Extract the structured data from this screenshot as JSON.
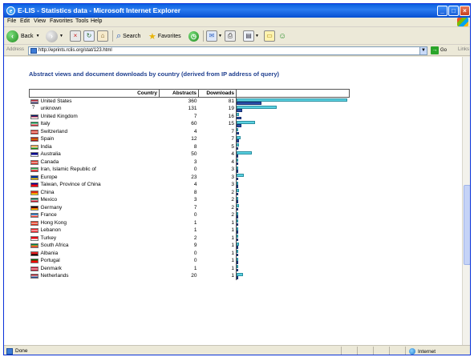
{
  "window": {
    "title": "E-LIS - Statistics data - Microsoft Internet Explorer",
    "controls": {
      "minimize": "_",
      "maximize": "□",
      "close": "×"
    }
  },
  "menu": [
    "File",
    "Edit",
    "View",
    "Favorites",
    "Tools",
    "Help"
  ],
  "toolbar": {
    "back_label": "Back",
    "search_label": "Search",
    "favorites_label": "Favorites"
  },
  "address": {
    "label": "Address",
    "url": "http://eprints.rclis.org/stat/123.html",
    "go_label": "Go",
    "links_label": "Links"
  },
  "page": {
    "heading": "Abstract views and document downloads by country (derived from IP address of query)",
    "columns": [
      "Country",
      "Abstracts",
      "Downloads"
    ],
    "max_value": 360,
    "rows": [
      {
        "country": "United States",
        "abstracts": "360",
        "downloads": "81",
        "flag": [
          "#b22234",
          "#ffffff",
          "#3c3b6e"
        ]
      },
      {
        "country": "unknown",
        "abstracts": "131",
        "downloads": "19",
        "flag": null
      },
      {
        "country": "United Kingdom",
        "abstracts": "7",
        "downloads": "16",
        "flag": [
          "#012169",
          "#c8102e",
          "#ffffff"
        ]
      },
      {
        "country": "Italy",
        "abstracts": "60",
        "downloads": "15",
        "flag": [
          "#009246",
          "#ffffff",
          "#ce2b37"
        ]
      },
      {
        "country": "Switzerland",
        "abstracts": "4",
        "downloads": "7",
        "flag": [
          "#d52b1e",
          "#ffffff",
          "#d52b1e"
        ]
      },
      {
        "country": "Spain",
        "abstracts": "12",
        "downloads": "7",
        "flag": [
          "#aa151b",
          "#f1bf00",
          "#aa151b"
        ]
      },
      {
        "country": "India",
        "abstracts": "8",
        "downloads": "5",
        "flag": [
          "#ff9933",
          "#ffffff",
          "#138808"
        ]
      },
      {
        "country": "Australia",
        "abstracts": "50",
        "downloads": "4",
        "flag": [
          "#00008b",
          "#00008b",
          "#ffffff"
        ]
      },
      {
        "country": "Canada",
        "abstracts": "3",
        "downloads": "4",
        "flag": [
          "#d52b1e",
          "#ffffff",
          "#d52b1e"
        ]
      },
      {
        "country": "Iran, Islamic Republic of",
        "abstracts": "0",
        "downloads": "3",
        "flag": [
          "#239f40",
          "#ffffff",
          "#da0000"
        ]
      },
      {
        "country": "Europe",
        "abstracts": "23",
        "downloads": "3",
        "flag": [
          "#003399",
          "#003399",
          "#ffcc00"
        ]
      },
      {
        "country": "Taiwan, Province of China",
        "abstracts": "4",
        "downloads": "3",
        "flag": [
          "#000095",
          "#fe0000",
          "#fe0000"
        ]
      },
      {
        "country": "China",
        "abstracts": "8",
        "downloads": "2",
        "flag": [
          "#de2910",
          "#de2910",
          "#ffde00"
        ]
      },
      {
        "country": "Mexico",
        "abstracts": "3",
        "downloads": "2",
        "flag": [
          "#006847",
          "#ffffff",
          "#ce1126"
        ]
      },
      {
        "country": "Germany",
        "abstracts": "7",
        "downloads": "2",
        "flag": [
          "#000000",
          "#dd0000",
          "#ffce00"
        ]
      },
      {
        "country": "France",
        "abstracts": "0",
        "downloads": "2",
        "flag": [
          "#0055a4",
          "#ffffff",
          "#ef4135"
        ]
      },
      {
        "country": "Hong Kong",
        "abstracts": "1",
        "downloads": "1",
        "flag": [
          "#de2910",
          "#ffffff",
          "#de2910"
        ]
      },
      {
        "country": "Lebanon",
        "abstracts": "1",
        "downloads": "1",
        "flag": [
          "#ed1c24",
          "#ffffff",
          "#ed1c24"
        ]
      },
      {
        "country": "Turkey",
        "abstracts": "2",
        "downloads": "1",
        "flag": [
          "#e30a17",
          "#e30a17",
          "#ffffff"
        ]
      },
      {
        "country": "South Africa",
        "abstracts": "9",
        "downloads": "1",
        "flag": [
          "#007a4d",
          "#ffb612",
          "#de3831"
        ]
      },
      {
        "country": "Albania",
        "abstracts": "0",
        "downloads": "1",
        "flag": [
          "#e41e20",
          "#e41e20",
          "#000000"
        ]
      },
      {
        "country": "Portugal",
        "abstracts": "0",
        "downloads": "1",
        "flag": [
          "#006600",
          "#ff0000",
          "#ff0000"
        ]
      },
      {
        "country": "Denmark",
        "abstracts": "1",
        "downloads": "1",
        "flag": [
          "#c8102e",
          "#ffffff",
          "#c8102e"
        ]
      },
      {
        "country": "Netherlands",
        "abstracts": "20",
        "downloads": "1",
        "flag": [
          "#ae1c28",
          "#ffffff",
          "#21468b"
        ]
      }
    ]
  },
  "status": {
    "text": "Done",
    "zone": "Internet"
  }
}
